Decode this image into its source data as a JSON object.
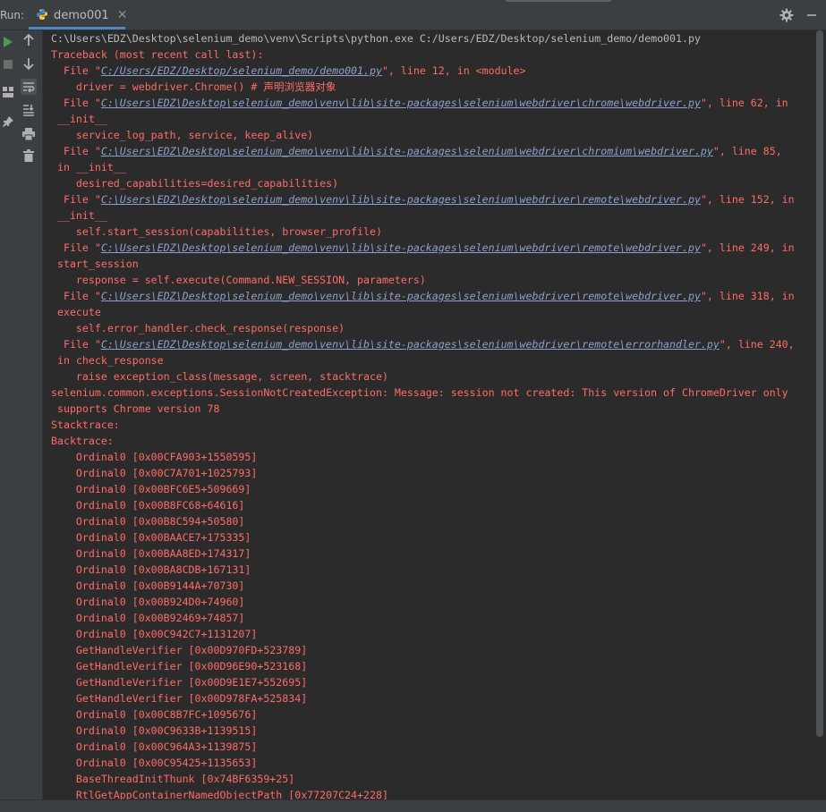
{
  "header": {
    "run_label": "Run:",
    "tab_label": "demo001",
    "tab_close": "✕"
  },
  "colors": {
    "background": "#2b2b2b",
    "panel": "#3c3f41",
    "error_text": "#ff6b68",
    "link_text": "#8f9fd0",
    "run_green": "#499c54"
  },
  "icons": {
    "rerun": "play-icon",
    "stop": "stop-icon",
    "layout": "layout-icon",
    "pin": "pin-icon",
    "up": "arrow-up-icon",
    "down": "arrow-down-icon",
    "wrap": "soft-wrap-icon",
    "scroll_end": "scroll-to-end-icon",
    "print": "print-icon",
    "trash": "trash-icon",
    "settings": "gear-icon",
    "minimize": "minimize-icon"
  },
  "console": {
    "lines": [
      {
        "segments": [
          {
            "t": "C:\\Users\\EDZ\\Desktop\\selenium_demo\\venv\\Scripts\\python.exe C:/Users/EDZ/Desktop/selenium_demo/demo001.py"
          }
        ]
      },
      {
        "err": true,
        "segments": [
          {
            "t": "Traceback (most recent call last):"
          }
        ]
      },
      {
        "err": true,
        "segments": [
          {
            "t": "  File \""
          },
          {
            "t": "C:/Users/EDZ/Desktop/selenium_demo/demo001.py",
            "link": true
          },
          {
            "t": "\", line 12, in <module>"
          }
        ]
      },
      {
        "err": true,
        "segments": [
          {
            "t": "    driver = webdriver.Chrome() # 声明浏览器对象"
          }
        ]
      },
      {
        "err": true,
        "segments": [
          {
            "t": "  File \""
          },
          {
            "t": "C:\\Users\\EDZ\\Desktop\\selenium_demo\\venv\\lib\\site-packages\\selenium\\webdriver\\chrome\\webdriver.py",
            "link": true
          },
          {
            "t": "\", line 62, in"
          }
        ]
      },
      {
        "err": true,
        "segments": [
          {
            "t": " __init__"
          }
        ]
      },
      {
        "err": true,
        "segments": [
          {
            "t": "    service_log_path, service, keep_alive)"
          }
        ]
      },
      {
        "err": true,
        "segments": [
          {
            "t": "  File \""
          },
          {
            "t": "C:\\Users\\EDZ\\Desktop\\selenium_demo\\venv\\lib\\site-packages\\selenium\\webdriver\\chromium\\webdriver.py",
            "link": true
          },
          {
            "t": "\", line 85,"
          }
        ]
      },
      {
        "err": true,
        "segments": [
          {
            "t": " in __init__"
          }
        ]
      },
      {
        "err": true,
        "segments": [
          {
            "t": "    desired_capabilities=desired_capabilities)"
          }
        ]
      },
      {
        "err": true,
        "segments": [
          {
            "t": "  File \""
          },
          {
            "t": "C:\\Users\\EDZ\\Desktop\\selenium_demo\\venv\\lib\\site-packages\\selenium\\webdriver\\remote\\webdriver.py",
            "link": true
          },
          {
            "t": "\", line 152, in"
          }
        ]
      },
      {
        "err": true,
        "segments": [
          {
            "t": " __init__"
          }
        ]
      },
      {
        "err": true,
        "segments": [
          {
            "t": "    self.start_session(capabilities, browser_profile)"
          }
        ]
      },
      {
        "err": true,
        "segments": [
          {
            "t": "  File \""
          },
          {
            "t": "C:\\Users\\EDZ\\Desktop\\selenium_demo\\venv\\lib\\site-packages\\selenium\\webdriver\\remote\\webdriver.py",
            "link": true
          },
          {
            "t": "\", line 249, in"
          }
        ]
      },
      {
        "err": true,
        "segments": [
          {
            "t": " start_session"
          }
        ]
      },
      {
        "err": true,
        "segments": [
          {
            "t": "    response = self.execute(Command.NEW_SESSION, parameters)"
          }
        ]
      },
      {
        "err": true,
        "segments": [
          {
            "t": "  File \""
          },
          {
            "t": "C:\\Users\\EDZ\\Desktop\\selenium_demo\\venv\\lib\\site-packages\\selenium\\webdriver\\remote\\webdriver.py",
            "link": true
          },
          {
            "t": "\", line 318, in"
          }
        ]
      },
      {
        "err": true,
        "segments": [
          {
            "t": " execute"
          }
        ]
      },
      {
        "err": true,
        "segments": [
          {
            "t": "    self.error_handler.check_response(response)"
          }
        ]
      },
      {
        "err": true,
        "segments": [
          {
            "t": "  File \""
          },
          {
            "t": "C:\\Users\\EDZ\\Desktop\\selenium_demo\\venv\\lib\\site-packages\\selenium\\webdriver\\remote\\errorhandler.py",
            "link": true
          },
          {
            "t": "\", line 240,"
          }
        ]
      },
      {
        "err": true,
        "segments": [
          {
            "t": " in check_response"
          }
        ]
      },
      {
        "err": true,
        "segments": [
          {
            "t": "    raise exception_class(message, screen, stacktrace)"
          }
        ]
      },
      {
        "err": true,
        "segments": [
          {
            "t": "selenium.common.exceptions.SessionNotCreatedException: Message: session not created: This version of ChromeDriver only"
          }
        ]
      },
      {
        "err": true,
        "segments": [
          {
            "t": " supports Chrome version 78"
          }
        ]
      },
      {
        "err": true,
        "segments": [
          {
            "t": "Stacktrace:"
          }
        ]
      },
      {
        "err": true,
        "segments": [
          {
            "t": "Backtrace:"
          }
        ]
      },
      {
        "err": true,
        "segments": [
          {
            "t": "    Ordinal0 [0x00CFA903+1550595]"
          }
        ]
      },
      {
        "err": true,
        "segments": [
          {
            "t": "    Ordinal0 [0x00C7A701+1025793]"
          }
        ]
      },
      {
        "err": true,
        "segments": [
          {
            "t": "    Ordinal0 [0x00BFC6E5+509669]"
          }
        ]
      },
      {
        "err": true,
        "segments": [
          {
            "t": "    Ordinal0 [0x00B8FC68+64616]"
          }
        ]
      },
      {
        "err": true,
        "segments": [
          {
            "t": "    Ordinal0 [0x00B8C594+50580]"
          }
        ]
      },
      {
        "err": true,
        "segments": [
          {
            "t": "    Ordinal0 [0x00BAACE7+175335]"
          }
        ]
      },
      {
        "err": true,
        "segments": [
          {
            "t": "    Ordinal0 [0x00BAA8ED+174317]"
          }
        ]
      },
      {
        "err": true,
        "segments": [
          {
            "t": "    Ordinal0 [0x00BA8CDB+167131]"
          }
        ]
      },
      {
        "err": true,
        "segments": [
          {
            "t": "    Ordinal0 [0x00B9144A+70730]"
          }
        ]
      },
      {
        "err": true,
        "segments": [
          {
            "t": "    Ordinal0 [0x00B924D0+74960]"
          }
        ]
      },
      {
        "err": true,
        "segments": [
          {
            "t": "    Ordinal0 [0x00B92469+74857]"
          }
        ]
      },
      {
        "err": true,
        "segments": [
          {
            "t": "    Ordinal0 [0x00C942C7+1131207]"
          }
        ]
      },
      {
        "err": true,
        "segments": [
          {
            "t": "    GetHandleVerifier [0x00D970FD+523789]"
          }
        ]
      },
      {
        "err": true,
        "segments": [
          {
            "t": "    GetHandleVerifier [0x00D96E90+523168]"
          }
        ]
      },
      {
        "err": true,
        "segments": [
          {
            "t": "    GetHandleVerifier [0x00D9E1E7+552695]"
          }
        ]
      },
      {
        "err": true,
        "segments": [
          {
            "t": "    GetHandleVerifier [0x00D978FA+525834]"
          }
        ]
      },
      {
        "err": true,
        "segments": [
          {
            "t": "    Ordinal0 [0x00C8B7FC+1095676]"
          }
        ]
      },
      {
        "err": true,
        "segments": [
          {
            "t": "    Ordinal0 [0x00C9633B+1139515]"
          }
        ]
      },
      {
        "err": true,
        "segments": [
          {
            "t": "    Ordinal0 [0x00C964A3+1139875]"
          }
        ]
      },
      {
        "err": true,
        "segments": [
          {
            "t": "    Ordinal0 [0x00C95425+1135653]"
          }
        ]
      },
      {
        "err": true,
        "segments": [
          {
            "t": "    BaseThreadInitThunk [0x74BF6359+25]"
          }
        ]
      },
      {
        "err": true,
        "segments": [
          {
            "t": "    RtlGetAppContainerNamedObjectPath [0x77207C24+228]"
          }
        ]
      }
    ]
  }
}
